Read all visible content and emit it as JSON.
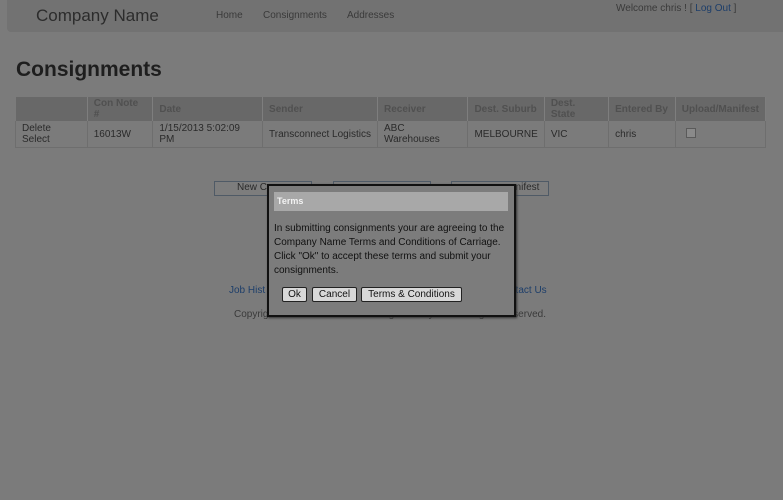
{
  "header": {
    "brand": "Company Name",
    "nav": [
      "Home",
      "Consignments",
      "Addresses"
    ],
    "welcome": "Welcome chris ! [",
    "logout": "Log Out",
    "welcome_end": "]"
  },
  "page_title": "Consignments",
  "table": {
    "columns": [
      "",
      "Con Note #",
      "Date",
      "Sender",
      "Receiver",
      "Dest. Suburb",
      "Dest. State",
      "Entered By",
      "Upload/Manifest"
    ],
    "rows": [
      {
        "actions": "Delete Select",
        "con_note": "16013W",
        "date": "1/15/2013 5:02:09 PM",
        "sender": "Transconnect Logistics",
        "receiver": "ABC Warehouses",
        "suburb": "MELBOURNE",
        "state": "VIC",
        "entered_by": "chris"
      }
    ]
  },
  "actions": {
    "new_label": "New C",
    "manifest_label": "anifest"
  },
  "footer": {
    "job_history": "Job Hist",
    "contact_us": "ntact Us",
    "copyright": "Copyright © 2012 Transconnect Logistics Pty Ltd. All Rights Reserved."
  },
  "dialog": {
    "title": "Terms",
    "message_lines": [
      "In submitting consignments your are agreeing to the",
      "Company Name Terms and Conditions of Carriage.",
      "Click \"Ok\" to accept these terms and submit your",
      "consignments."
    ],
    "ok_label": "Ok",
    "cancel_label": "Cancel",
    "terms_label": "Terms & Conditions"
  }
}
